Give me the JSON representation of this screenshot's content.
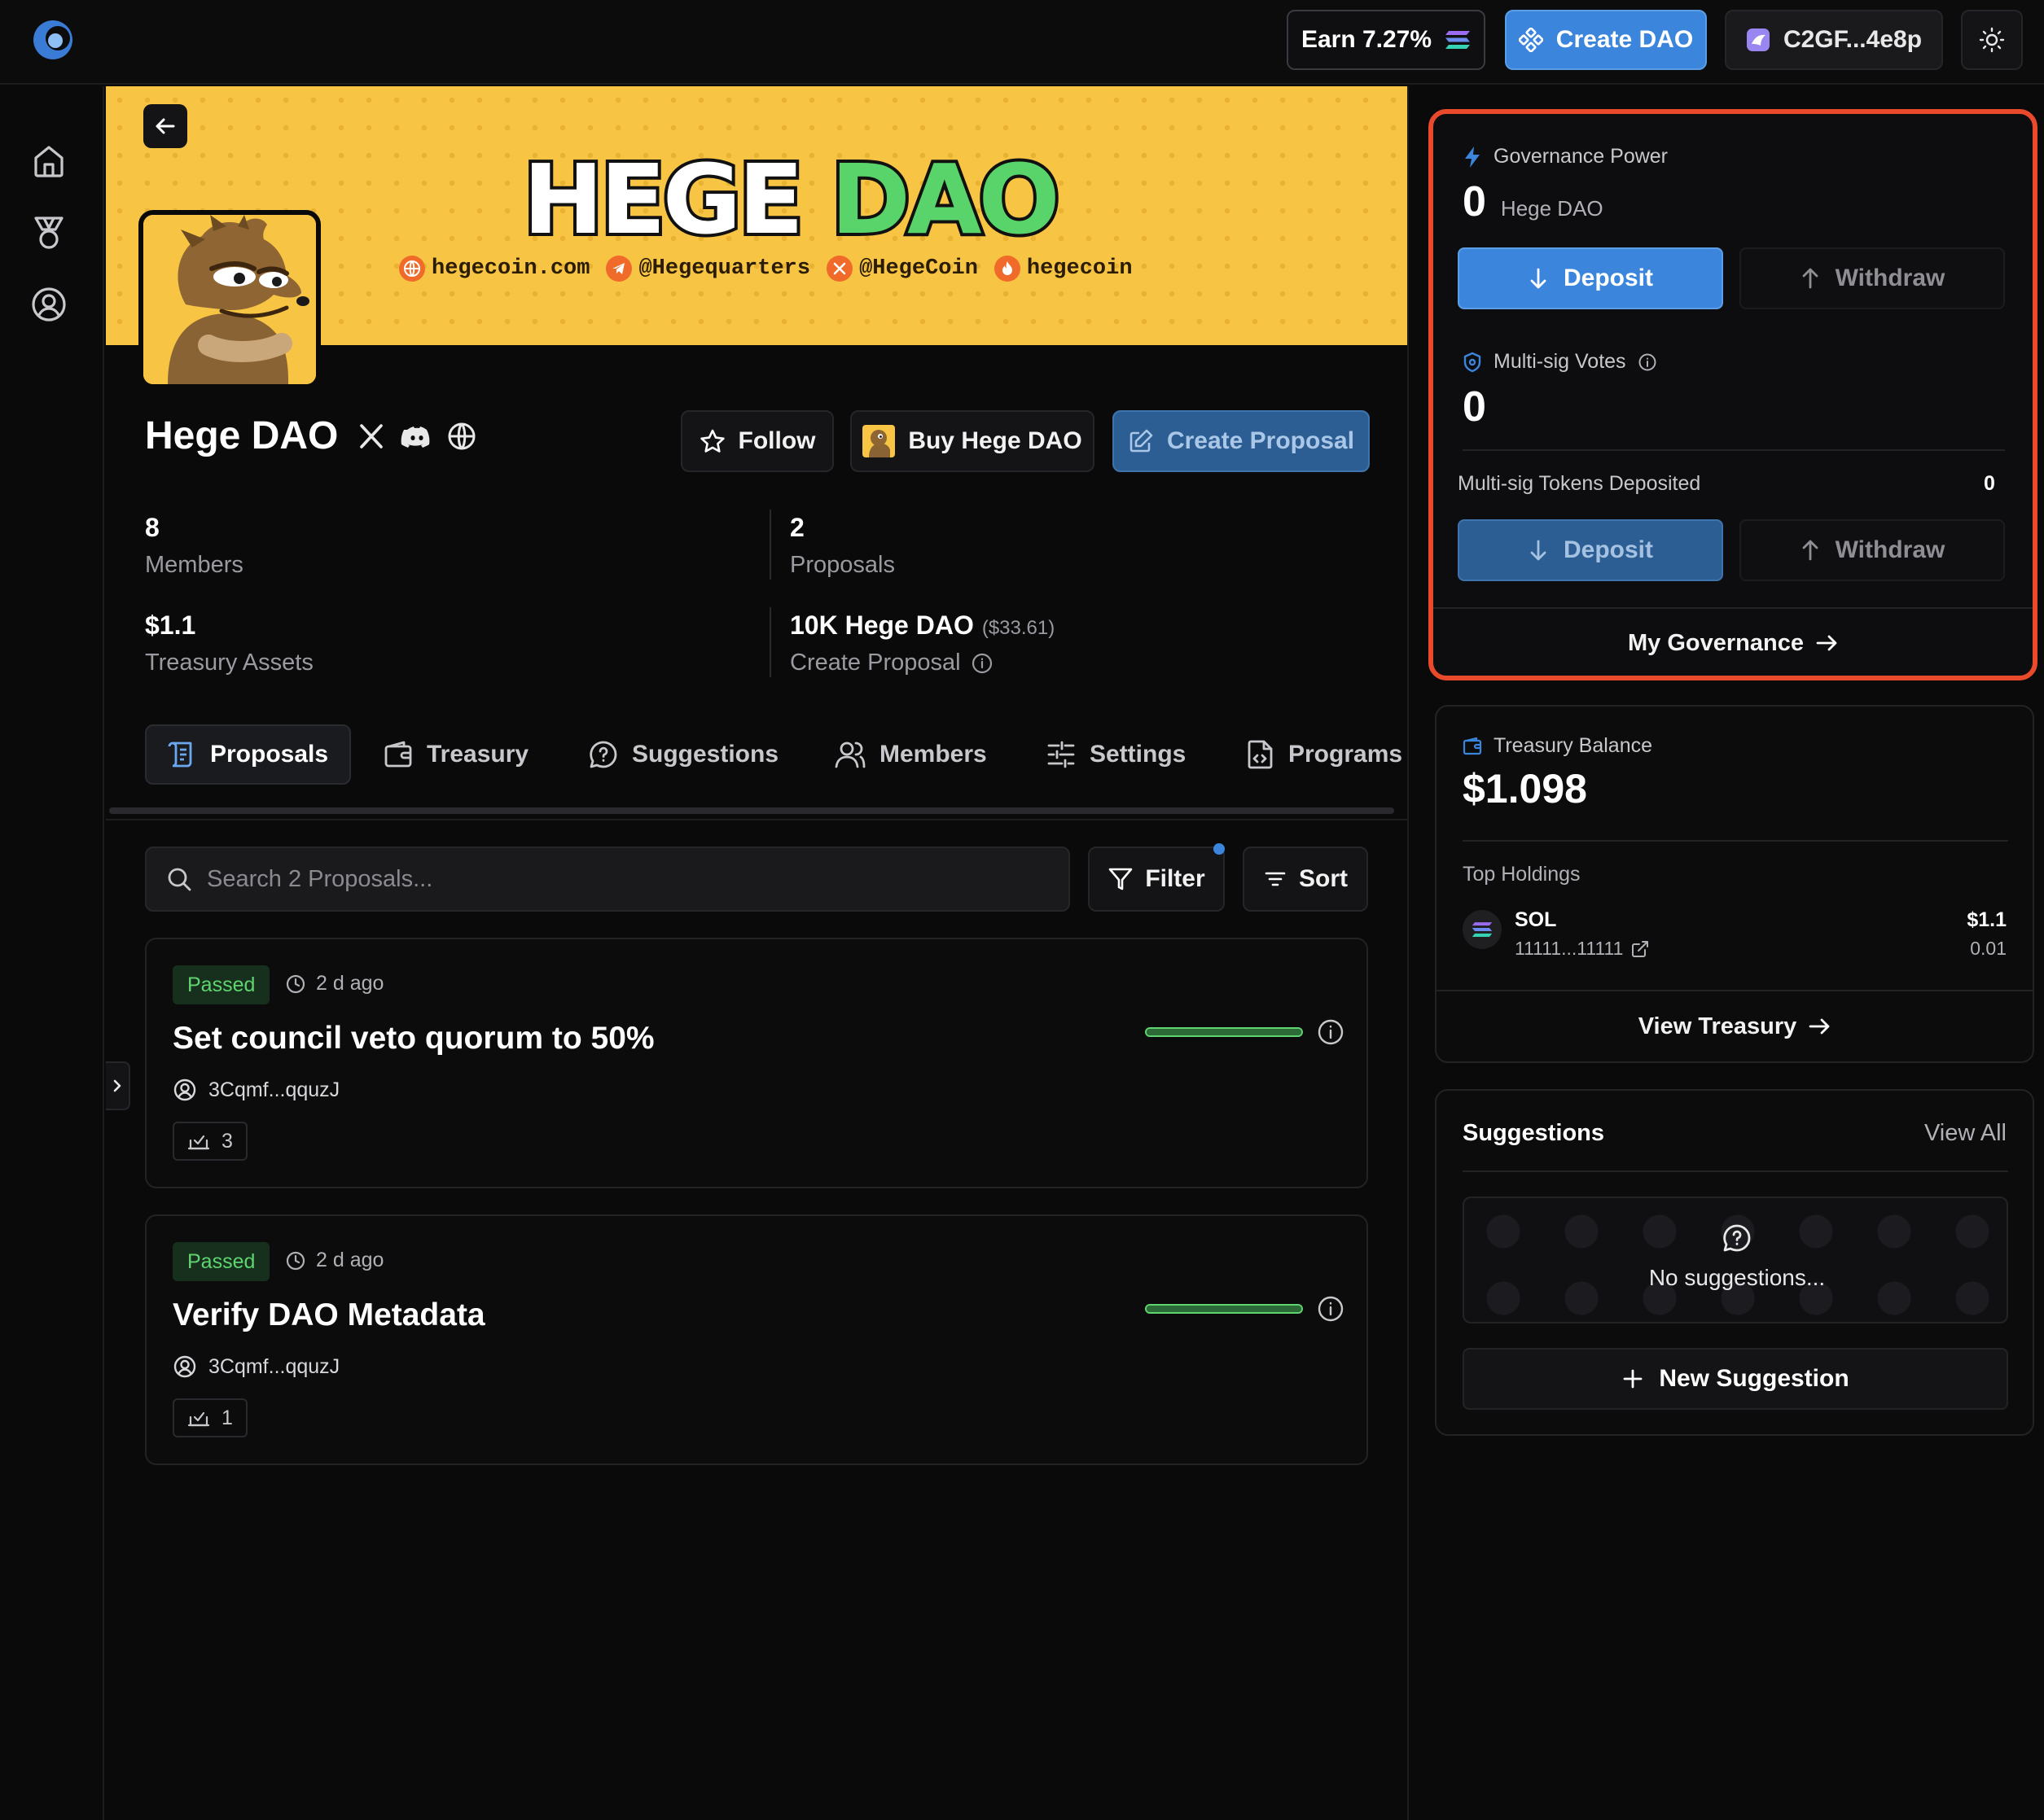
{
  "topbar": {
    "earn_label": "Earn 7.27%",
    "create_dao_label": "Create DAO",
    "wallet_label": "C2GF...4e8p"
  },
  "banner": {
    "title_part1": "HEGE",
    "title_part2": "DAO",
    "links": [
      "hegecoin.com",
      "@Hegequarters",
      "@HegeCoin",
      "hegecoin"
    ]
  },
  "dao": {
    "name": "Hege DAO",
    "follow_label": "Follow",
    "buy_label": "Buy Hege DAO",
    "create_proposal_label": "Create Proposal"
  },
  "stats": {
    "members_value": "8",
    "members_label": "Members",
    "proposals_value": "2",
    "proposals_label": "Proposals",
    "treasury_value": "$1.1",
    "treasury_label": "Treasury Assets",
    "threshold_value": "10K Hege DAO",
    "threshold_usd": "($33.61)",
    "threshold_label": "Create Proposal"
  },
  "tabs": [
    {
      "label": "Proposals"
    },
    {
      "label": "Treasury"
    },
    {
      "label": "Suggestions"
    },
    {
      "label": "Members"
    },
    {
      "label": "Settings"
    },
    {
      "label": "Programs"
    }
  ],
  "search": {
    "placeholder": "Search 2 Proposals...",
    "filter_label": "Filter",
    "sort_label": "Sort"
  },
  "proposals": [
    {
      "status": "Passed",
      "time": "2 d ago",
      "title": "Set council veto quorum to 50%",
      "author": "3Cqmf...qquzJ",
      "votes": "3",
      "progress": 1.0
    },
    {
      "status": "Passed",
      "time": "2 d ago",
      "title": "Verify DAO Metadata",
      "author": "3Cqmf...qquzJ",
      "votes": "1",
      "progress": 1.0
    }
  ],
  "governance": {
    "power_label": "Governance Power",
    "power_value": "0",
    "power_token": "Hege DAO",
    "deposit_label": "Deposit",
    "withdraw_label": "Withdraw",
    "multisig_label": "Multi-sig Votes",
    "multisig_value": "0",
    "multisig_tokens_label": "Multi-sig Tokens Deposited",
    "multisig_tokens_value": "0",
    "my_governance_label": "My Governance"
  },
  "treasury": {
    "balance_label": "Treasury Balance",
    "balance_value": "$1.098",
    "top_holdings_label": "Top Holdings",
    "holding_symbol": "SOL",
    "holding_address": "11111...11111",
    "holding_usd": "$1.1",
    "holding_amount": "0.01",
    "view_label": "View Treasury"
  },
  "suggestions": {
    "title": "Suggestions",
    "view_all_label": "View All",
    "empty_label": "No suggestions...",
    "new_label": "New Suggestion"
  },
  "colors": {
    "accent": "#3b86dc",
    "passed": "#5fd46f",
    "highlight": "#ea4a2c",
    "banner": "#f7c443"
  }
}
